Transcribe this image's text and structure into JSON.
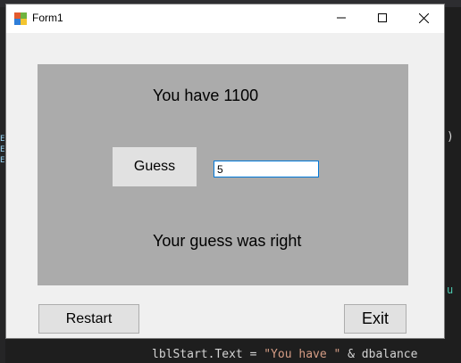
{
  "window": {
    "title": "Form1",
    "icon": "winforms-app-icon",
    "controls": {
      "minimize_icon": "minimize-icon",
      "maximize_icon": "maximize-icon",
      "close_icon": "close-icon"
    }
  },
  "panel": {
    "start_label": "You have 1100",
    "guess_button_label": "Guess",
    "guess_input_value": "5",
    "result_label": "Your guess was right"
  },
  "footer": {
    "restart_label": "Restart",
    "exit_label": "Exit"
  },
  "background_ide": {
    "code_line_prefix": "lblStart.Text = ",
    "code_line_string": "\"You have \"",
    "code_line_suffix": " & dbalance",
    "right_paren": ")",
    "right_fragment": "u",
    "left_fragments": [
      "E",
      "E",
      "E",
      "n"
    ]
  },
  "colors": {
    "form_background": "#f0f0f0",
    "panel_background": "#ababab",
    "input_focus_border": "#0078d7",
    "button_face": "#e1e1e1"
  }
}
